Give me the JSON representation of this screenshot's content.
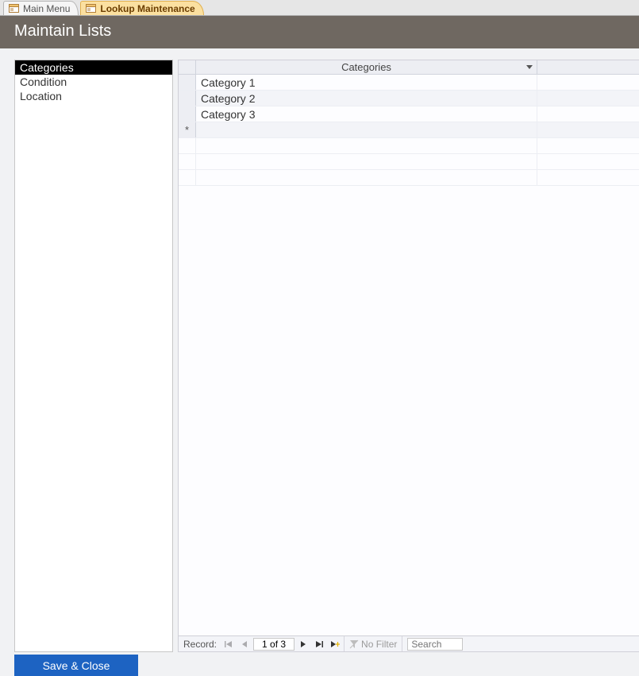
{
  "tabs": [
    {
      "label": "Main Menu",
      "active": false
    },
    {
      "label": "Lookup Maintenance",
      "active": true
    }
  ],
  "page_title": "Maintain Lists",
  "sidebar": {
    "items": [
      {
        "label": "Categories",
        "selected": true
      },
      {
        "label": "Condition",
        "selected": false
      },
      {
        "label": "Location",
        "selected": false
      }
    ]
  },
  "grid": {
    "column_header": "Categories",
    "rows": [
      {
        "value": "Category 1"
      },
      {
        "value": "Category 2"
      },
      {
        "value": "Category 3"
      }
    ],
    "new_row_marker": "*"
  },
  "recnav": {
    "label": "Record:",
    "position": "1 of 3",
    "filter_label": "No Filter",
    "search_placeholder": "Search"
  },
  "buttons": {
    "save_close": "Save & Close"
  }
}
